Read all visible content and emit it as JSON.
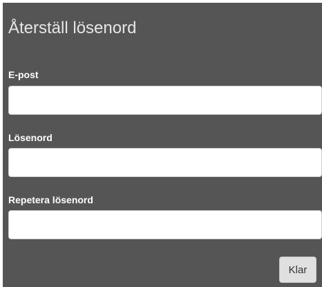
{
  "form": {
    "title": "Återställ lösenord",
    "email_label": "E-post",
    "email_value": "",
    "password_label": "Lösenord",
    "password_value": "",
    "repeat_label": "Repetera lösenord",
    "repeat_value": "",
    "submit_label": "Klar"
  },
  "colors": {
    "panel_bg": "#555555",
    "title_text": "#e6e6e6",
    "label_text": "#ffffff",
    "button_bg": "#e0e0e0"
  }
}
